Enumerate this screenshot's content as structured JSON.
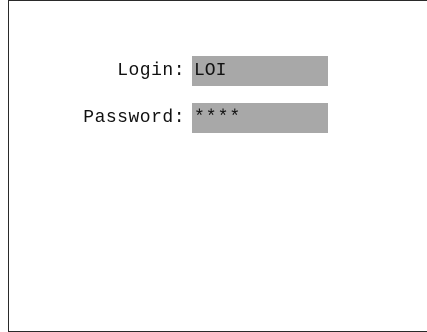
{
  "form": {
    "login_label": "Login:",
    "login_value": "LOI",
    "password_label": "Password:",
    "password_value": "****"
  }
}
